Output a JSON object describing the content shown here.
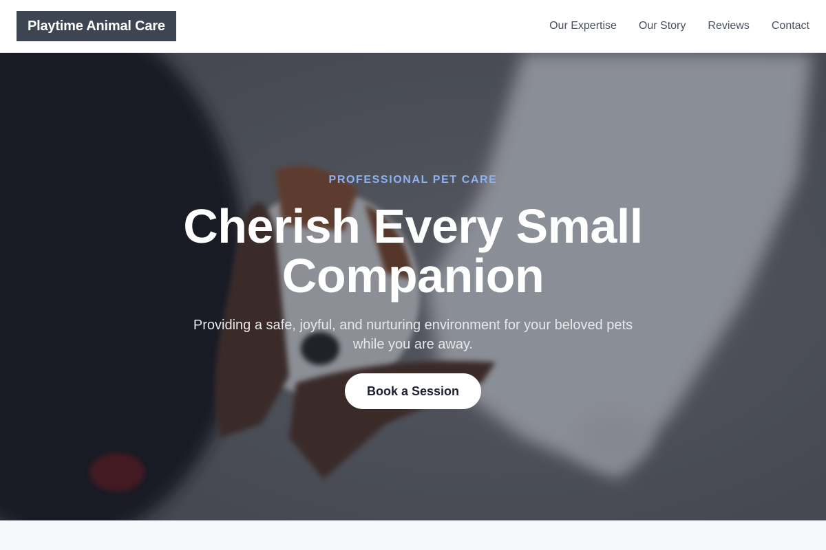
{
  "header": {
    "logo": "Playtime Animal Care",
    "nav": [
      {
        "label": "Our Expertise"
      },
      {
        "label": "Our Story"
      },
      {
        "label": "Reviews"
      },
      {
        "label": "Contact"
      }
    ]
  },
  "hero": {
    "eyebrow": "PROFESSIONAL PET CARE",
    "title": "Cherish Every Small Companion",
    "subtitle": "Providing a safe, joyful, and nurturing environment for your beloved pets while you are away.",
    "cta": "Book a Session"
  },
  "colors": {
    "logo_bg": "#3d4553",
    "eyebrow": "#8fb3f0",
    "overlay": "rgba(20,24,40,0.45)"
  }
}
